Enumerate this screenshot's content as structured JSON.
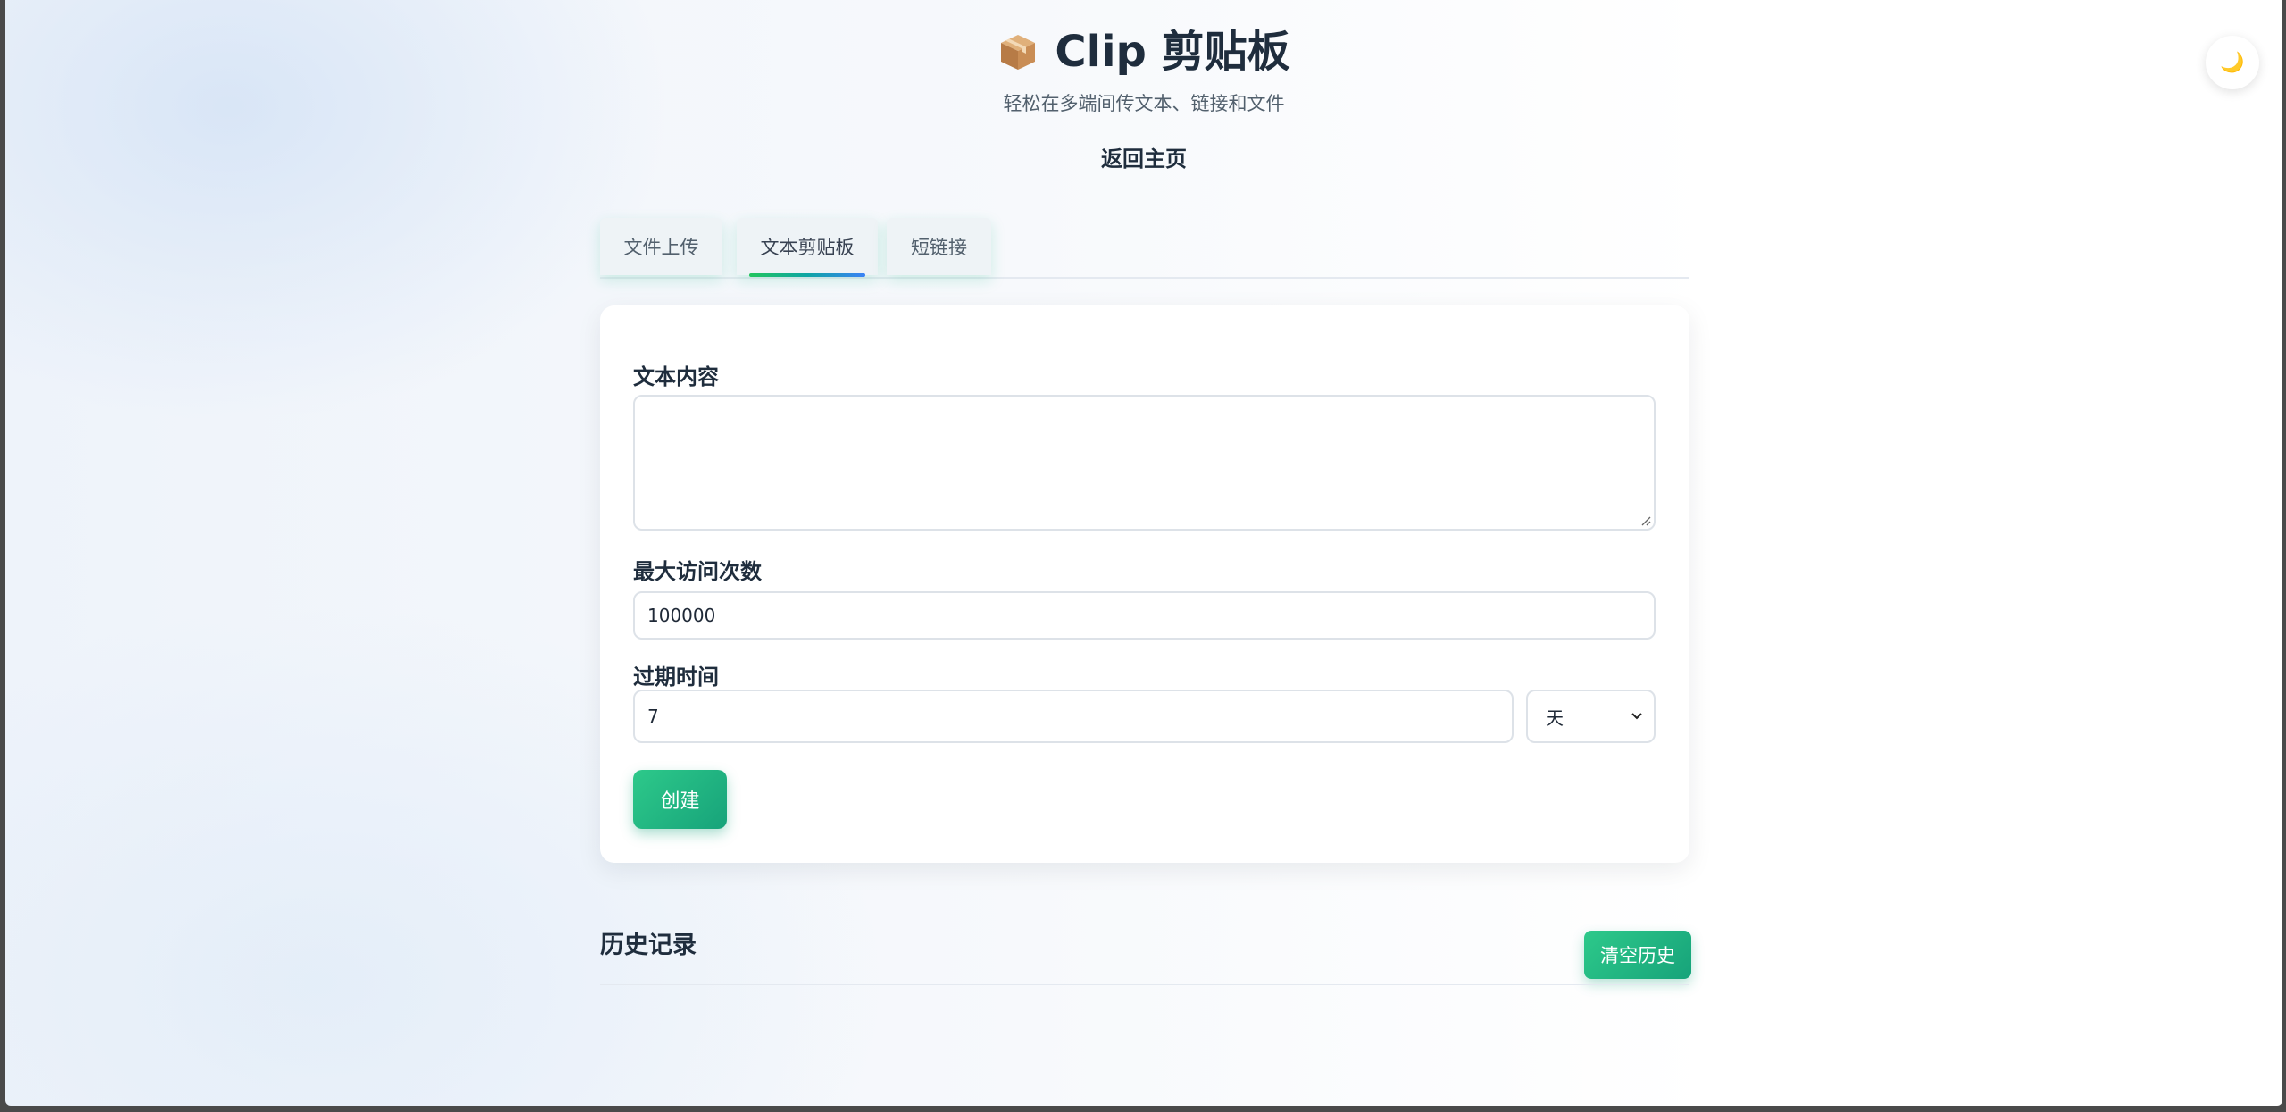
{
  "app": {
    "title": "Clip 剪贴板",
    "subtitle": "轻松在多端间传文本、链接和文件",
    "home_link": "返回主页",
    "logo_icon": "package-box-icon",
    "theme_toggle_icon": "moon-icon",
    "theme_toggle_glyph": "🌙"
  },
  "tabs": [
    {
      "label": "文件上传",
      "active": false
    },
    {
      "label": "文本剪贴板",
      "active": true
    },
    {
      "label": "短链接",
      "active": false
    }
  ],
  "form": {
    "text_label": "文本内容",
    "text_value": "",
    "max_visits_label": "最大访问次数",
    "max_visits_value": "100000",
    "expire_label": "过期时间",
    "expire_value": "7",
    "expire_unit": "天",
    "create_label": "创建"
  },
  "history": {
    "title": "历史记录",
    "clear_label": "清空历史"
  },
  "colors": {
    "accent_green": "#22c55e",
    "accent_teal": "#17a37a",
    "text_dark": "#1f2d3d"
  }
}
